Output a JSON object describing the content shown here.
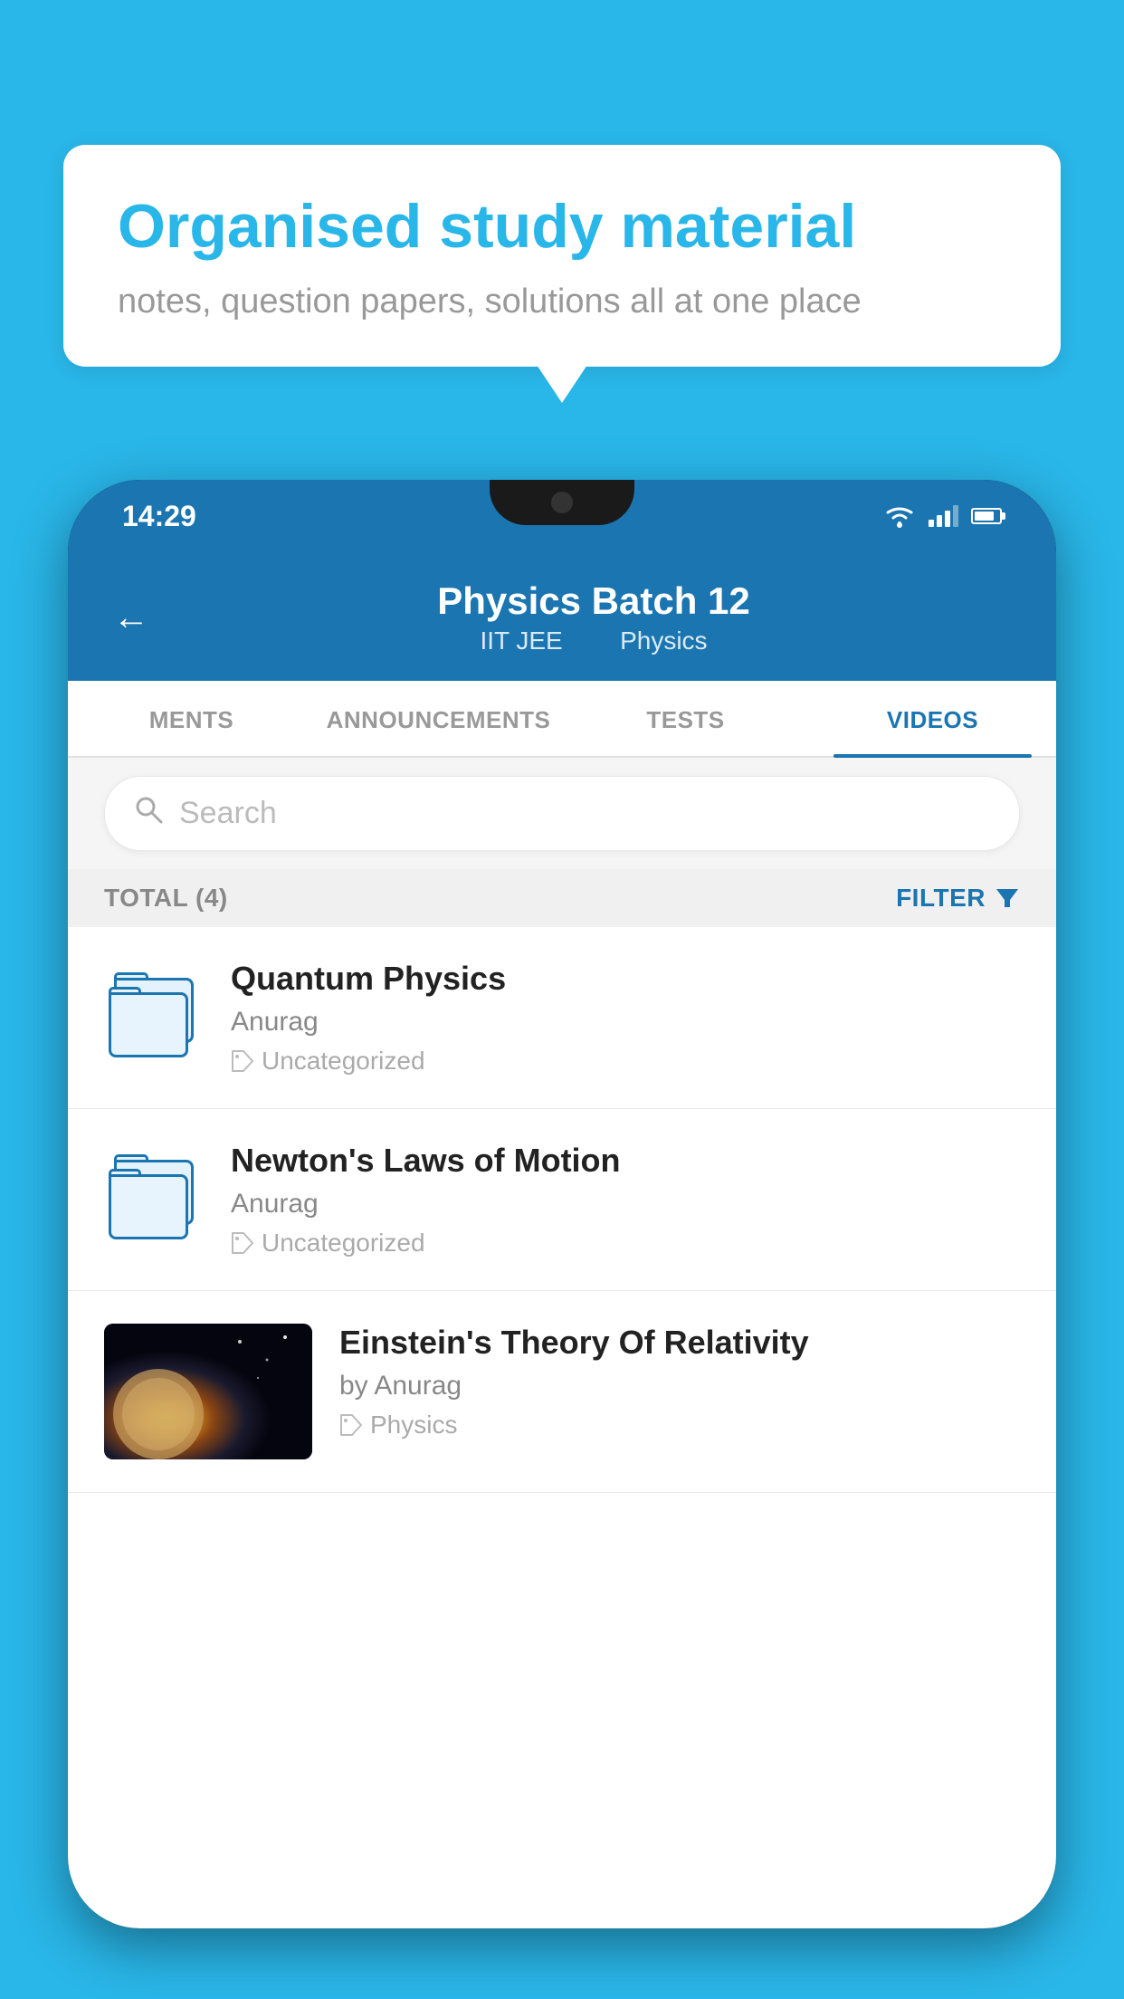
{
  "background": {
    "color": "#29b6e8"
  },
  "speech_bubble": {
    "title": "Organised study material",
    "subtitle": "notes, question papers, solutions all at one place"
  },
  "phone": {
    "status_bar": {
      "time": "14:29"
    },
    "header": {
      "title": "Physics Batch 12",
      "subtitle_part1": "IIT JEE",
      "subtitle_part2": "Physics",
      "back_label": "←"
    },
    "tabs": [
      {
        "label": "MENTS",
        "active": false
      },
      {
        "label": "ANNOUNCEMENTS",
        "active": false
      },
      {
        "label": "TESTS",
        "active": false
      },
      {
        "label": "VIDEOS",
        "active": true
      }
    ],
    "search": {
      "placeholder": "Search"
    },
    "filter_bar": {
      "total_label": "TOTAL (4)",
      "filter_label": "FILTER"
    },
    "videos": [
      {
        "title": "Quantum Physics",
        "author": "Anurag",
        "tag": "Uncategorized",
        "type": "folder"
      },
      {
        "title": "Newton's Laws of Motion",
        "author": "Anurag",
        "tag": "Uncategorized",
        "type": "folder"
      },
      {
        "title": "Einstein's Theory Of Relativity",
        "author": "by Anurag",
        "tag": "Physics",
        "type": "video"
      }
    ]
  }
}
